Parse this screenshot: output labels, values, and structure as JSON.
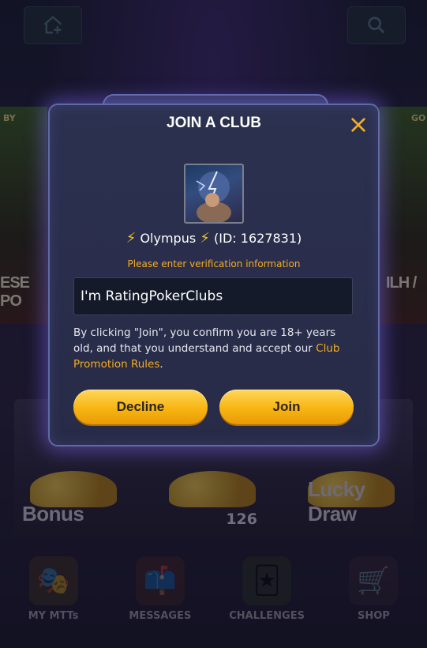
{
  "background": {
    "left_card_label": "BY",
    "left_card_text": "ESE PO",
    "right_card_label": "GO",
    "right_card_text": "ILH /",
    "tiles": [
      {
        "name": "Bonus",
        "count": ""
      },
      {
        "name": "",
        "count": "126"
      },
      {
        "name": "Lucky Draw",
        "count": ""
      }
    ]
  },
  "nav": {
    "items": [
      {
        "label": "MY MTTs",
        "icon": "masks-icon"
      },
      {
        "label": "MESSAGES",
        "icon": "mailbox-icon"
      },
      {
        "label": "CHALLENGES",
        "icon": "cards-icon"
      },
      {
        "label": "SHOP",
        "icon": "shopping-cart-icon"
      }
    ]
  },
  "modal": {
    "title": "JOIN A CLUB",
    "club_name": "Olympus",
    "club_id_text": "(ID: 1627831)",
    "verify_prompt": "Please enter verification information",
    "input_value": "I'm RatingPokerClubs",
    "terms_text": "By clicking \"Join\", you confirm you are 18+ years old, and that you understand and accept our",
    "terms_link": "Club Promotion Rules",
    "terms_end": ".",
    "decline_label": "Decline",
    "join_label": "Join"
  },
  "colors": {
    "accent": "#f4ad1f",
    "button": "#f7b511",
    "modal_bg": "#2c3150"
  }
}
